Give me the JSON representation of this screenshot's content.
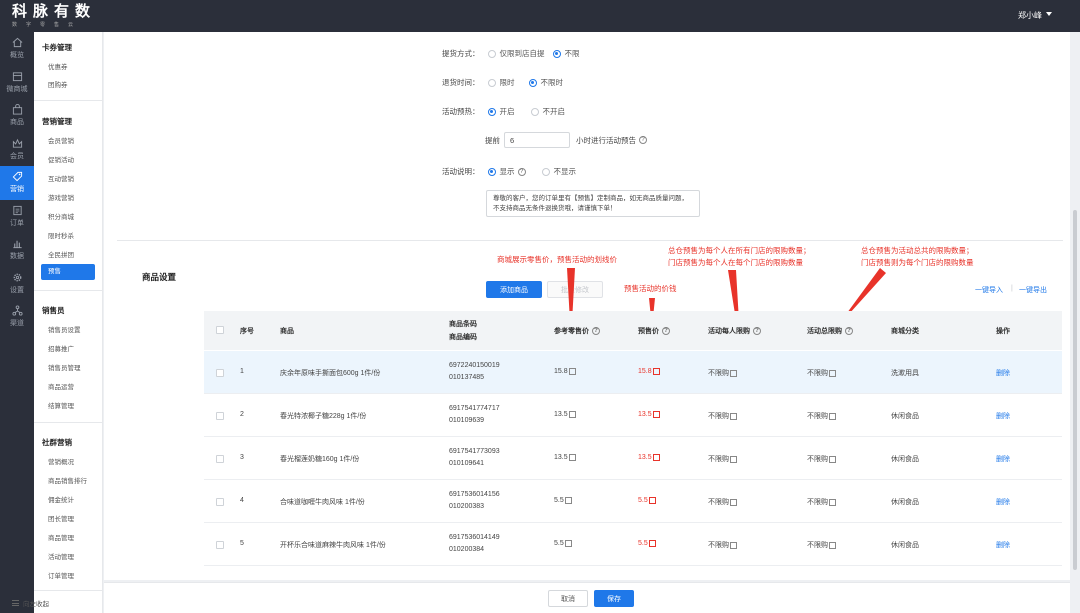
{
  "header": {
    "logo_main": "科脉有数",
    "logo_sub": "数字零售云",
    "user_name": "郑小峰"
  },
  "rail": [
    {
      "label": "概览",
      "icon": "home-icon"
    },
    {
      "label": "微商城",
      "icon": "store-icon"
    },
    {
      "label": "商品",
      "icon": "bag-icon"
    },
    {
      "label": "会员",
      "icon": "crown-icon"
    },
    {
      "label": "营销",
      "icon": "tag-icon",
      "active": true
    },
    {
      "label": "订单",
      "icon": "order-icon"
    },
    {
      "label": "数据",
      "icon": "chart-icon"
    },
    {
      "label": "设置",
      "icon": "gear-icon"
    },
    {
      "label": "渠道",
      "icon": "channel-icon"
    }
  ],
  "subnav": {
    "groups": [
      {
        "title": "卡券管理",
        "items": [
          "优惠券",
          "团购券"
        ]
      },
      {
        "title": "营销管理",
        "items": [
          "会员营销",
          "促销活动",
          "互动营销",
          "游戏营销",
          "积分商城",
          "限时秒杀",
          "全民拼团",
          "预售"
        ]
      },
      {
        "title": "销售员",
        "items": [
          "销售员设置",
          "招募推广",
          "销售员管理",
          "商品运营",
          "结算管理"
        ]
      },
      {
        "title": "社群营销",
        "items": [
          "营销概况",
          "商品销售排行",
          "佣金统计",
          "团长管理",
          "商品管理",
          "活动管理",
          "订单管理"
        ]
      }
    ],
    "active_item": "预售",
    "collapse_label": "向左收起"
  },
  "form": {
    "pickup": {
      "label": "提货方式：",
      "options": [
        "仅限到店自提",
        "不限"
      ],
      "selected": 1
    },
    "pickup_time": {
      "label": "退货时间：",
      "options": [
        "限时",
        "不限时"
      ],
      "selected": 1
    },
    "preview": {
      "label": "活动预热：",
      "options": [
        "开启",
        "不开启"
      ],
      "selected": 0
    },
    "advance": {
      "prefix": "提前",
      "value": "6",
      "suffix": "小时进行活动预告"
    },
    "desc": {
      "label": "活动说明：",
      "options": [
        "显示",
        "不显示"
      ],
      "selected": 0
    },
    "desc_text": "尊敬的客户，您的订单里有【预售】定制商品，如无商品质量问题，不支持商品无条件退换货哦，请谨慎下单！"
  },
  "section": {
    "title": "商品设置",
    "add_button": "添加商品",
    "batch_button": "批量修改",
    "import_link": "一键导入",
    "export_link": "一键导出"
  },
  "annotations": {
    "a1": "商城展示零售价，预售活动的划线价",
    "a2": "预售活动的价钱",
    "a3_line1": "总仓预售为每个人在所有门店的限购数量；",
    "a3_line2": "门店预售为每个人在每个门店的限购数量",
    "a4_line1": "总仓预售为活动总共的限购数量；",
    "a4_line2": "门店预售则为每个门店的限购数量"
  },
  "table": {
    "headers": {
      "seq": "序号",
      "name": "商品",
      "code1": "商品条码",
      "code2": "商品编码",
      "ref_price": "参考零售价",
      "pre_price": "预售价",
      "limit_person": "活动每人限购",
      "limit_total": "活动总限购",
      "category": "商城分类",
      "op": "操作"
    },
    "rows": [
      {
        "seq": "1",
        "name": "庆余年原味手撕面包600g 1件/份",
        "barcode": "6972240150019",
        "code": "010137485",
        "ref_price": "15.8",
        "pre_price": "15.8",
        "limit_person": "不限购",
        "limit_total": "不限购",
        "category": "洗漱用具",
        "op": "删除"
      },
      {
        "seq": "2",
        "name": "春光特浓椰子糖228g 1件/份",
        "barcode": "6917541774717",
        "code": "010109639",
        "ref_price": "13.5",
        "pre_price": "13.5",
        "limit_person": "不限购",
        "limit_total": "不限购",
        "category": "休闲食品",
        "op": "删除"
      },
      {
        "seq": "3",
        "name": "春光榴莲奶糖160g 1件/份",
        "barcode": "6917541773093",
        "code": "010109641",
        "ref_price": "13.5",
        "pre_price": "13.5",
        "limit_person": "不限购",
        "limit_total": "不限购",
        "category": "休闲食品",
        "op": "删除"
      },
      {
        "seq": "4",
        "name": "合味道咖喱牛肉风味 1件/份",
        "barcode": "6917536014156",
        "code": "010200383",
        "ref_price": "5.5",
        "pre_price": "5.5",
        "limit_person": "不限购",
        "limit_total": "不限购",
        "category": "休闲食品",
        "op": "删除"
      },
      {
        "seq": "5",
        "name": "开杯乐合味道麻辣牛肉风味 1件/份",
        "barcode": "6917536014149",
        "code": "010200384",
        "ref_price": "5.5",
        "pre_price": "5.5",
        "limit_person": "不限购",
        "limit_total": "不限购",
        "category": "休闲食品",
        "op": "删除"
      }
    ]
  },
  "footer": {
    "cancel": "取消",
    "save": "保存"
  },
  "colors": {
    "primary": "#1f78e9",
    "annotation": "#e8332a",
    "dark": "#2b2f3a"
  }
}
